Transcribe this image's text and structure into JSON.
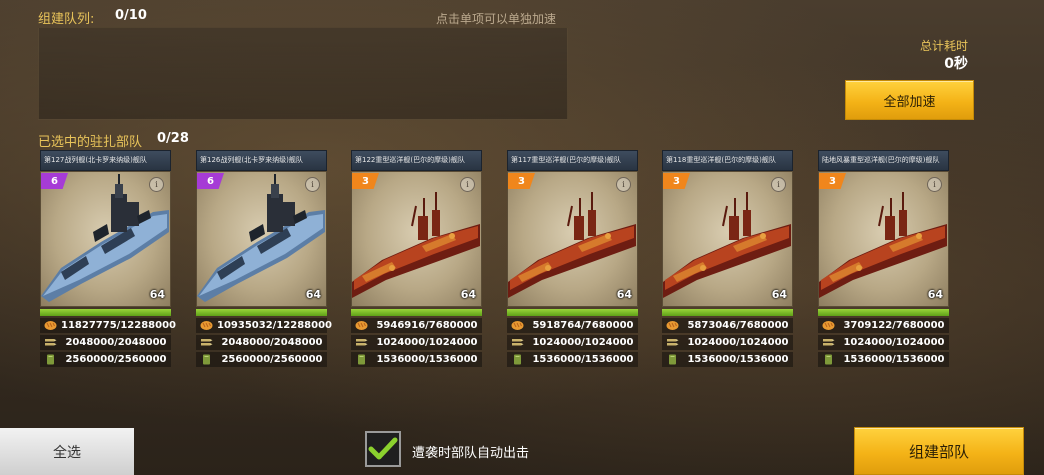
{
  "queue": {
    "title": "组建队列:",
    "count": "0/10",
    "hint": "点击单项可以单独加速"
  },
  "total_time": {
    "label": "总计耗时",
    "value": "0秒"
  },
  "speed_all_label": "全部加速",
  "selected": {
    "title": "已选中的驻扎部队",
    "count": "0/28"
  },
  "units": [
    {
      "name": "第127战列舰(北卡罗来纳级)舰队",
      "level": "6",
      "level_color": "#a63bd6",
      "ship": "battleship",
      "power": "64",
      "food": "11827775/12288000",
      "ammo": "2048000/2048000",
      "fuel": "2560000/2560000"
    },
    {
      "name": "第126战列舰(北卡罗来纳级)舰队",
      "level": "6",
      "level_color": "#a63bd6",
      "ship": "battleship",
      "power": "64",
      "food": "10935032/12288000",
      "ammo": "2048000/2048000",
      "fuel": "2560000/2560000"
    },
    {
      "name": "第122重型巡洋舰(巴尔的摩级)舰队",
      "level": "3",
      "level_color": "#f0861c",
      "ship": "cruiser",
      "power": "64",
      "food": "5946916/7680000",
      "ammo": "1024000/1024000",
      "fuel": "1536000/1536000"
    },
    {
      "name": "第117重型巡洋舰(巴尔的摩级)舰队",
      "level": "3",
      "level_color": "#f0861c",
      "ship": "cruiser",
      "power": "64",
      "food": "5918764/7680000",
      "ammo": "1024000/1024000",
      "fuel": "1536000/1536000"
    },
    {
      "name": "第118重型巡洋舰(巴尔的摩级)舰队",
      "level": "3",
      "level_color": "#f0861c",
      "ship": "cruiser",
      "power": "64",
      "food": "5873046/7680000",
      "ammo": "1024000/1024000",
      "fuel": "1536000/1536000"
    },
    {
      "name": "陆地风暴重型巡洋舰(巴尔的摩级)舰队",
      "level": "3",
      "level_color": "#f0861c",
      "ship": "cruiser",
      "power": "64",
      "food": "3709122/7680000",
      "ammo": "1024000/1024000",
      "fuel": "1536000/1536000"
    }
  ],
  "resource_icons": [
    "bread-icon",
    "ammo-icon",
    "fuel-icon"
  ],
  "select_all_label": "全选",
  "auto_sortie": {
    "label": "遭袭时部队自动出击",
    "checked": true
  },
  "build_label": "组建部队"
}
